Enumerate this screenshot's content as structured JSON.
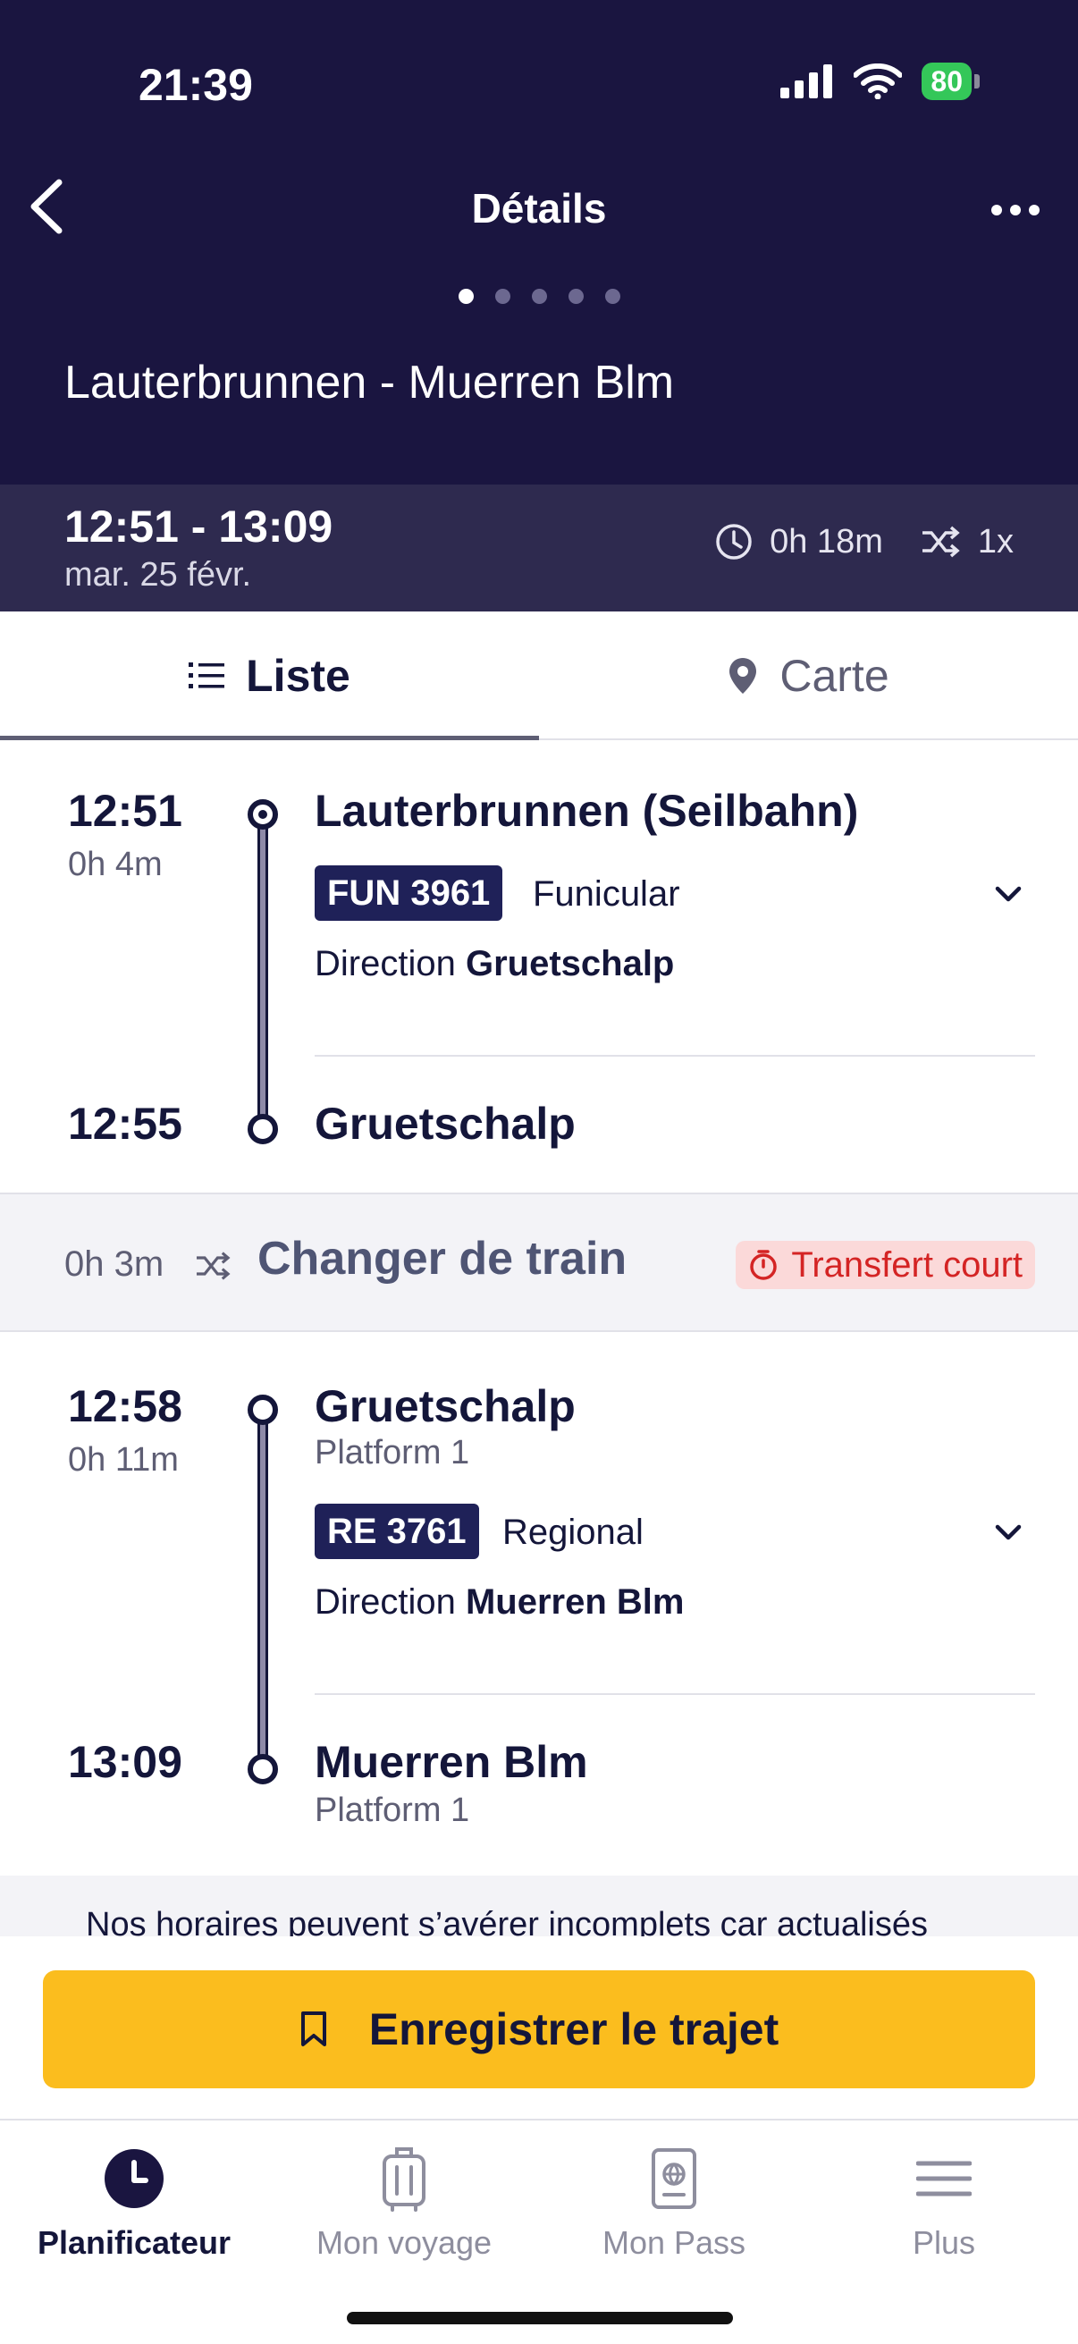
{
  "status_bar": {
    "time": "21:39",
    "battery": "80"
  },
  "header": {
    "title": "Détails",
    "route": "Lauterbrunnen - Muerren Blm",
    "page_count": 5,
    "active_page": 1
  },
  "summary": {
    "times": "12:51 - 13:09",
    "date": "mar. 25 févr.",
    "duration": "0h 18m",
    "transfers": "1x"
  },
  "tabs": {
    "list": "Liste",
    "map": "Carte"
  },
  "legs": [
    {
      "dep_time": "12:51",
      "duration": "0h 4m",
      "dep_station": "Lauterbrunnen (Seilbahn)",
      "train": "FUN 3961",
      "mode": "Funicular",
      "direction_label": "Direction",
      "direction": "Gruetschalp",
      "arr_time": "12:55",
      "arr_station": "Gruetschalp"
    },
    {
      "dep_time": "12:58",
      "duration": "0h 11m",
      "dep_station": "Gruetschalp",
      "dep_platform": "Platform 1",
      "train": "RE 3761",
      "mode": "Regional",
      "direction_label": "Direction",
      "direction": "Muerren Blm",
      "arr_time": "13:09",
      "arr_station": "Muerren Blm",
      "arr_platform": "Platform 1"
    }
  ],
  "transfer": {
    "duration": "0h 3m",
    "label": "Changer de train",
    "warning": "Transfert court"
  },
  "disclaimer": "Nos horaires peuvent s’avérer incomplets car actualisés",
  "save_button": "Enregistrer le trajet",
  "nav": [
    {
      "label": "Planificateur",
      "icon": "clock-icon",
      "active": true
    },
    {
      "label": "Mon voyage",
      "icon": "luggage-icon",
      "active": false
    },
    {
      "label": "Mon Pass",
      "icon": "passport-icon",
      "active": false
    },
    {
      "label": "Plus",
      "icon": "menu-icon",
      "active": false
    }
  ],
  "colors": {
    "header_bg": "#1a1540",
    "summary_bg": "#2e2a4f",
    "badge_bg": "#1f2158",
    "accent_yellow": "#fbbd1e",
    "warning_red": "#d42424",
    "battery_green": "#34c759"
  }
}
